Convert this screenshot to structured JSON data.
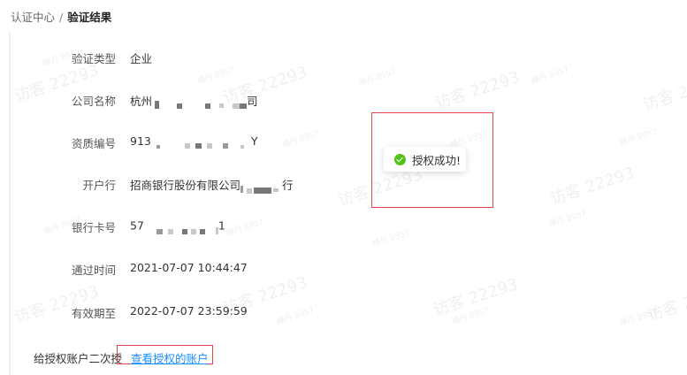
{
  "breadcrumb": {
    "parent": "认证中心",
    "separator": "/",
    "current": "验证结果"
  },
  "details": {
    "verify_type": {
      "label": "验证类型",
      "value": "企业"
    },
    "company_name": {
      "label": "公司名称",
      "value_prefix": "杭州",
      "value_suffix": "司"
    },
    "qualification_no": {
      "label": "资质编号",
      "value_prefix": "913",
      "value_suffix": "Y"
    },
    "bank": {
      "label": "开户行",
      "value_prefix": "招商银行股份有限公司",
      "value_suffix": "行"
    },
    "card_no": {
      "label": "银行卡号",
      "value_prefix": "57",
      "value_suffix": "1"
    },
    "pass_time": {
      "label": "通过时间",
      "value": "2021-07-07 10:44:47"
    },
    "valid_until": {
      "label": "有效期至",
      "value": "2022-07-07 23:59:59"
    }
  },
  "toast": {
    "message": "授权成功!",
    "icon": "check-circle-icon",
    "color": "#52c41a"
  },
  "footer": {
    "prompt": "给授权账户二次授",
    "link_text": "查看授权的账户"
  },
  "watermark": {
    "main": "访客 22293",
    "sub": "臻丹 8957"
  },
  "colors": {
    "highlight_border": "#e0474c",
    "link": "#1890ff",
    "success": "#52c41a"
  }
}
